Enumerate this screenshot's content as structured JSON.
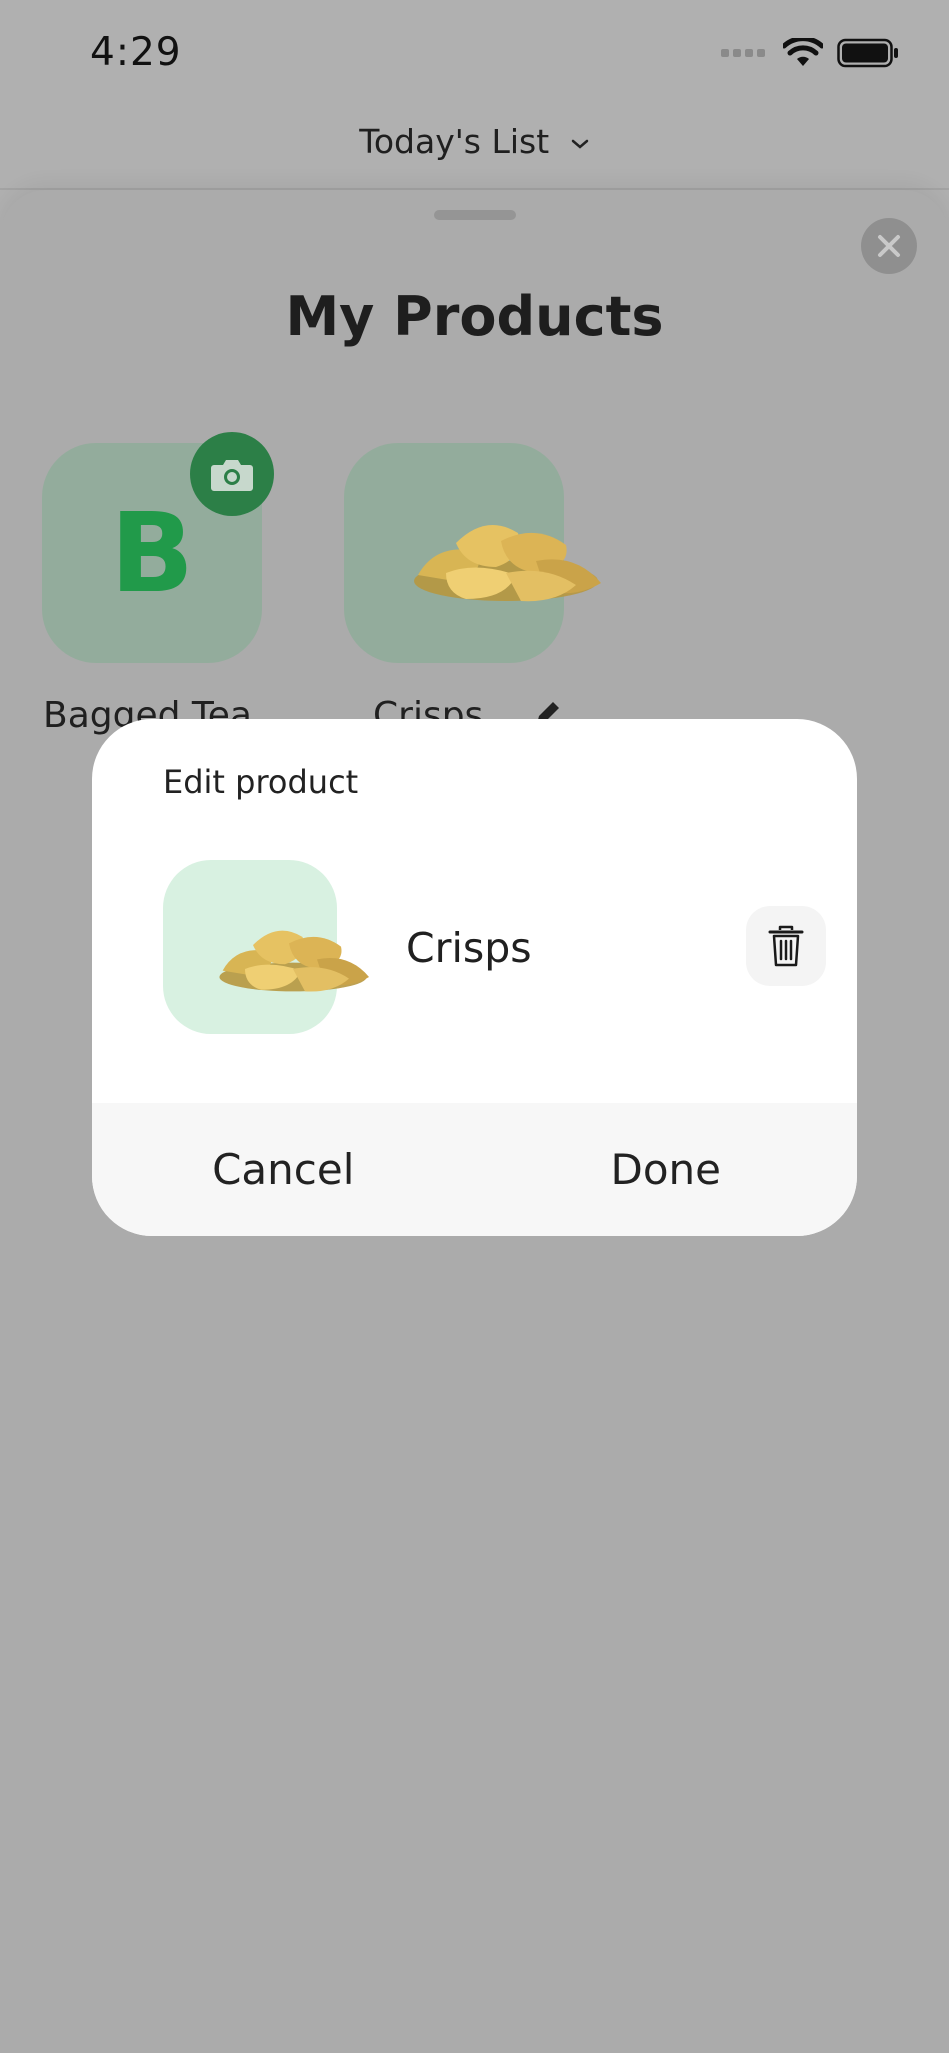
{
  "status_bar": {
    "time": "4:29",
    "signal_icon": "signal-dots-icon",
    "wifi_icon": "wifi-icon",
    "battery_icon": "battery-icon"
  },
  "list_selector": {
    "title": "Today's List",
    "icon": "chevron-down-icon"
  },
  "sheet": {
    "title": "My Products",
    "close_icon": "close-icon",
    "products": [
      {
        "label": "Bagged Tea",
        "tile_letter": "B",
        "badge_icon": "camera-icon"
      },
      {
        "label": "Crisps",
        "image": "crisps-image",
        "edit_icon": "pencil-icon"
      }
    ]
  },
  "dialog": {
    "title": "Edit product",
    "product_name": "Crisps",
    "delete_icon": "trash-icon",
    "cancel_label": "Cancel",
    "done_label": "Done"
  },
  "colors": {
    "overlay": "#b0b0b0",
    "tile_green": "#93ac9c",
    "brand_green": "#219a4a",
    "thumb_bg": "#d8f1e1"
  }
}
